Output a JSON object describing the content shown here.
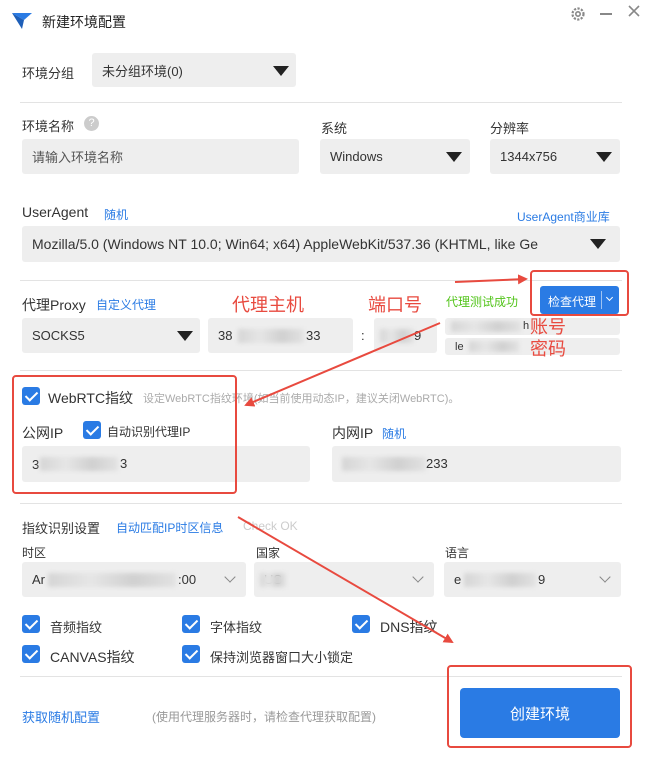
{
  "window": {
    "title": "新建环境配置"
  },
  "group": {
    "label": "环境分组",
    "value": "未分组环境(0)"
  },
  "env_name": {
    "label": "环境名称",
    "placeholder": "请输入环境名称"
  },
  "system": {
    "label": "系统",
    "value": "Windows"
  },
  "resolution": {
    "label": "分辨率",
    "value": "1344x756"
  },
  "useragent": {
    "label": "UserAgent",
    "random": "随机",
    "store": "UserAgent商业库",
    "value": "Mozilla/5.0 (Windows NT 10.0; Win64; x64) AppleWebKit/537.36 (KHTML, like Ge"
  },
  "proxy": {
    "label": "代理Proxy",
    "custom": "自定义代理",
    "success": "代理测试成功",
    "check_button": "检查代理",
    "type": "SOCKS5",
    "host": "38",
    "host_tail": "33",
    "colon": ":",
    "port_tail": "9",
    "user_tail": "h",
    "pass_head": "le"
  },
  "annotations": {
    "host": "代理主机",
    "port": "端口号",
    "account": "账号",
    "password": "密码"
  },
  "webrtc": {
    "label": "WebRTC指纹",
    "hint": "设定WebRTC指纹环境(如当前使用动态IP，建议关闭WebRTC)。",
    "public_ip_label": "公网IP",
    "auto_label": "自动识别代理IP",
    "public_ip_head": "3",
    "public_ip_tail": "3",
    "lan_ip_label": "内网IP",
    "lan_random": "随机",
    "lan_ip_tail": "233"
  },
  "fingerprint": {
    "label": "指纹识别设置",
    "auto_match": "自动匹配IP时区信息",
    "check_status": "Check OK",
    "timezone_label": "时区",
    "timezone_head": "Ar",
    "timezone_tail": ":00",
    "country_label": "国家",
    "country_value": "US",
    "language_label": "语言",
    "language_head": "e",
    "language_tail": "9"
  },
  "options": {
    "audio": "音频指纹",
    "font": "字体指纹",
    "dns": "DNS指纹",
    "canvas": "CANVAS指纹",
    "lock_size": "保持浏览器窗口大小锁定"
  },
  "footer": {
    "random_config": "获取随机配置",
    "hint": "(使用代理服务器时，请检查代理获取配置)",
    "create_button": "创建环境"
  },
  "colors": {
    "accent": "#2a7be4",
    "annotation": "#e84a3f",
    "success": "#52c41a"
  }
}
